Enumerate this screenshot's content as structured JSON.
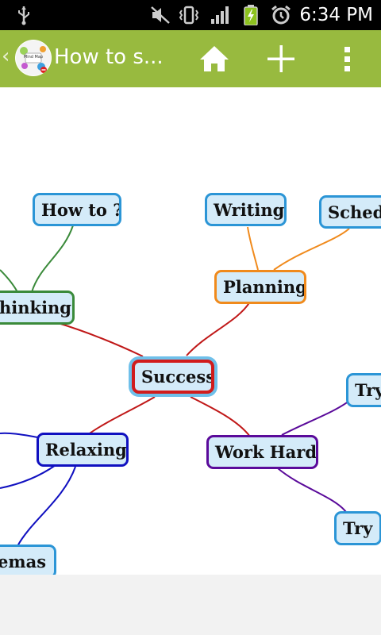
{
  "status_bar": {
    "time": "6:34 PM",
    "icons": [
      "usb-icon",
      "mute-icon",
      "vibrate-icon",
      "signal-icon",
      "battery-charging-icon",
      "alarm-icon"
    ]
  },
  "action_bar": {
    "title": "How to s...",
    "logo_text": "Mind Map",
    "icons": [
      "home-icon",
      "add-icon",
      "overflow-menu-icon"
    ]
  },
  "colors": {
    "action_bar": "#98ba3f",
    "node_fill": "#d4ebf9",
    "node_border": "#2b95d6",
    "center_border": "#d11c1c",
    "branch_thinking": "#3a8a3a",
    "branch_planning": "#f08a1c",
    "branch_relaxing": "#1010c0",
    "branch_workhard": "#5a0a9a",
    "center_links": "#c01818"
  },
  "mindmap": {
    "center": "Success",
    "nodes": {
      "how_to": "How to ?",
      "writing": "Writing",
      "schedule": "Schedu",
      "planning": "Planning",
      "thinking": "hinking",
      "relaxing": "Relaxing",
      "work_hard": "Work Hard",
      "try_1": "Try",
      "try_2": "Try",
      "cinemas": "emas"
    }
  }
}
